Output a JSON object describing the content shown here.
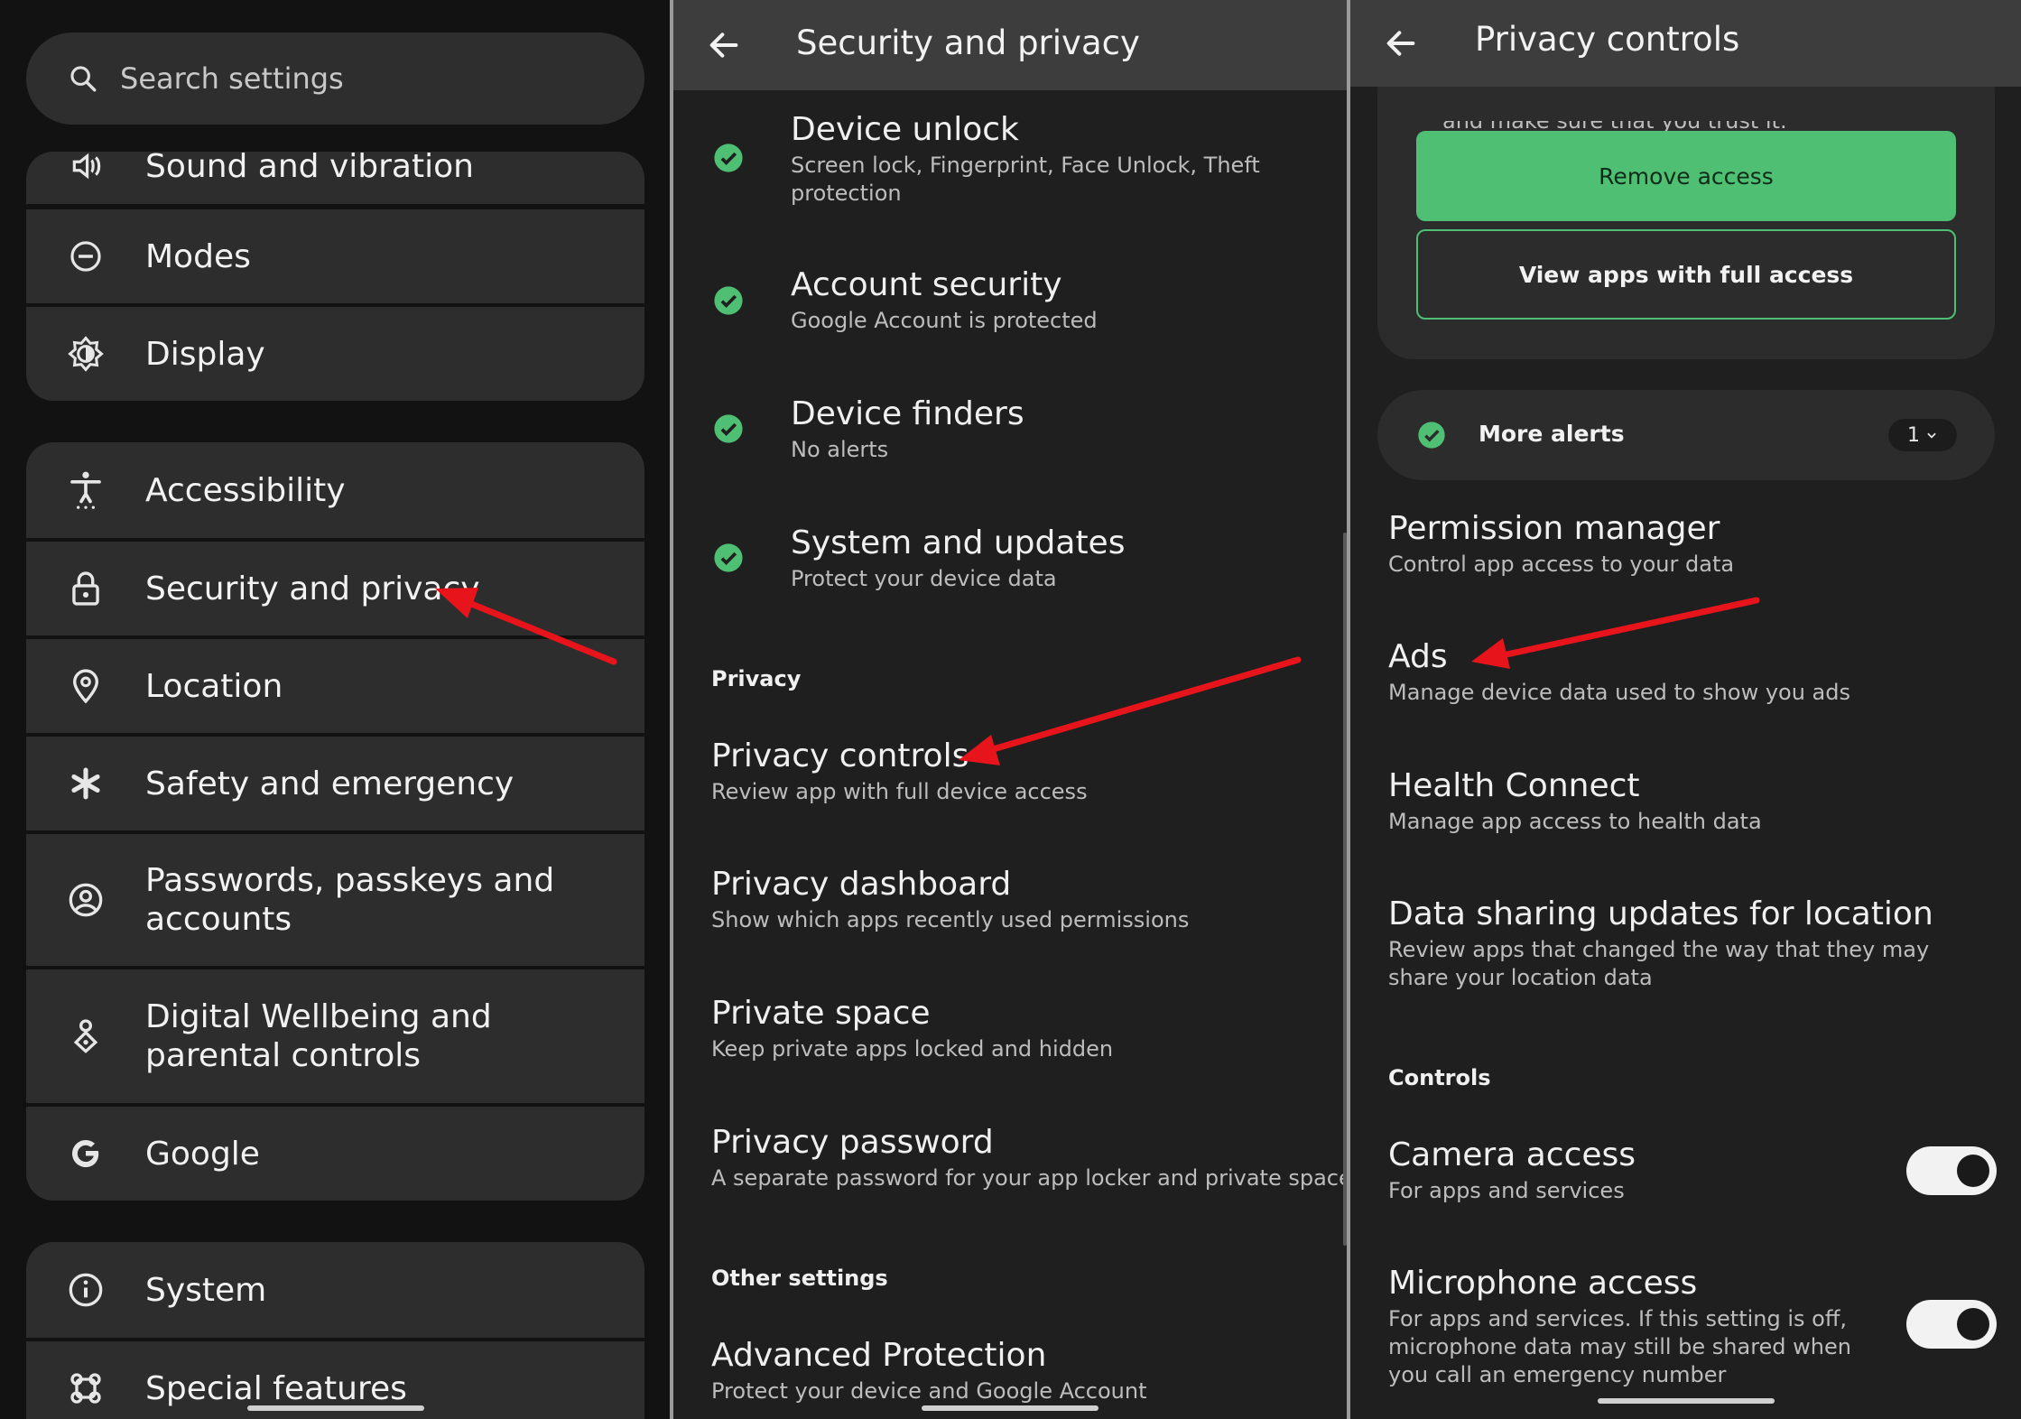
{
  "settings": {
    "search_placeholder": "Search settings",
    "items": [
      {
        "label": "Sound and vibration",
        "icon": "speaker-icon"
      },
      {
        "label": "Modes",
        "icon": "modes-icon"
      },
      {
        "label": "Display",
        "icon": "brightness-icon"
      },
      {
        "label": "Accessibility",
        "icon": "accessibility-icon"
      },
      {
        "label": "Security and privacy",
        "icon": "lock-icon"
      },
      {
        "label": "Location",
        "icon": "location-pin-icon"
      },
      {
        "label": "Safety and emergency",
        "icon": "asterisk-icon"
      },
      {
        "label": "Passwords, passkeys and accounts",
        "icon": "account-circle-icon"
      },
      {
        "label": "Digital Wellbeing and parental controls",
        "icon": "wellbeing-icon"
      },
      {
        "label": "Google",
        "icon": "google-g-icon"
      },
      {
        "label": "System",
        "icon": "info-icon"
      },
      {
        "label": "Special features",
        "icon": "special-features-icon"
      }
    ]
  },
  "security": {
    "title": "Security and privacy",
    "status_items": [
      {
        "title": "Device unlock",
        "subtitle": "Screen lock, Fingerprint, Face Unlock, Theft protection"
      },
      {
        "title": "Account security",
        "subtitle": "Google Account is protected"
      },
      {
        "title": "Device finders",
        "subtitle": "No alerts"
      },
      {
        "title": "System and updates",
        "subtitle": "Protect your device data"
      }
    ],
    "privacy_header": "Privacy",
    "privacy_items": [
      {
        "title": "Privacy controls",
        "subtitle": "Review app with full device access"
      },
      {
        "title": "Privacy dashboard",
        "subtitle": "Show which apps recently used permissions"
      },
      {
        "title": "Private space",
        "subtitle": "Keep private apps locked and hidden"
      },
      {
        "title": "Privacy password",
        "subtitle": "A separate password for your app locker and private space"
      }
    ],
    "other_header": "Other settings",
    "other_items": [
      {
        "title": "Advanced Protection",
        "subtitle": "Protect your device and Google Account"
      }
    ]
  },
  "privacy_controls": {
    "title": "Privacy controls",
    "cut_text": "and make sure that you trust it.",
    "remove_access": "Remove access",
    "view_apps": "View apps with full access",
    "more_alerts": "More alerts",
    "alerts_count": "1",
    "items": [
      {
        "title": "Permission manager",
        "subtitle": "Control app access to your data"
      },
      {
        "title": "Ads",
        "subtitle": "Manage device data used to show you ads"
      },
      {
        "title": "Health Connect",
        "subtitle": "Manage app access to health data"
      },
      {
        "title": "Data sharing updates for location",
        "subtitle": "Review apps that changed the way that they may share your location data"
      }
    ],
    "controls_header": "Controls",
    "toggles": [
      {
        "title": "Camera access",
        "subtitle": "For apps and services",
        "on": true
      },
      {
        "title": "Microphone access",
        "subtitle": "For apps and services. If this setting is off, microphone data may still be shared when you call an emergency number",
        "on": true
      }
    ]
  },
  "colors": {
    "accent_green": "#4fbf74",
    "annotation_red": "#e8141b",
    "surface": "#2d2d2d"
  }
}
